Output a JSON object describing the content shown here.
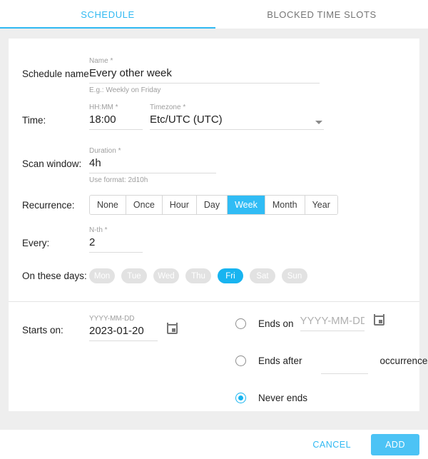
{
  "tabs": [
    {
      "label": "SCHEDULE",
      "active": true
    },
    {
      "label": "BLOCKED TIME SLOTS",
      "active": false
    }
  ],
  "form": {
    "schedule_name": {
      "row_label": "Schedule name",
      "field_label": "Name *",
      "value": "Every other week",
      "hint": "E.g.: Weekly on Friday"
    },
    "time": {
      "row_label": "Time:",
      "hhmm_label": "HH:MM *",
      "hhmm_value": "18:00",
      "timezone_label": "Timezone *",
      "timezone_value": "Etc/UTC (UTC)"
    },
    "scan_window": {
      "row_label": "Scan window:",
      "field_label": "Duration *",
      "value": "4h",
      "hint": "Use format: 2d10h"
    },
    "recurrence": {
      "row_label": "Recurrence:",
      "options": [
        "None",
        "Once",
        "Hour",
        "Day",
        "Week",
        "Month",
        "Year"
      ],
      "selected": "Week"
    },
    "every": {
      "row_label": "Every:",
      "field_label": "N-th *",
      "value": "2"
    },
    "days": {
      "row_label": "On these days:",
      "options": [
        "Mon",
        "Tue",
        "Wed",
        "Thu",
        "Fri",
        "Sat",
        "Sun"
      ],
      "selected": [
        "Fri"
      ]
    },
    "starts_on": {
      "row_label": "Starts on:",
      "field_label": "YYYY-MM-DD",
      "value": "2023-01-20"
    },
    "ends": {
      "selected": "never",
      "ends_on_label": "Ends on",
      "ends_on_placeholder": "YYYY-MM-DD",
      "ends_on_value": "",
      "ends_after_label": "Ends after",
      "ends_after_value": "",
      "occurrences_label": "occurrences",
      "never_ends_label": "Never ends"
    }
  },
  "footer": {
    "cancel_label": "CANCEL",
    "add_label": "ADD"
  },
  "colors": {
    "accent": "#30b9f2",
    "accent_fill": "#30bcf5",
    "chip_selected": "#18b4f0",
    "chip_unselected": "#e2e2e2",
    "page_bg": "#eeeeee"
  }
}
